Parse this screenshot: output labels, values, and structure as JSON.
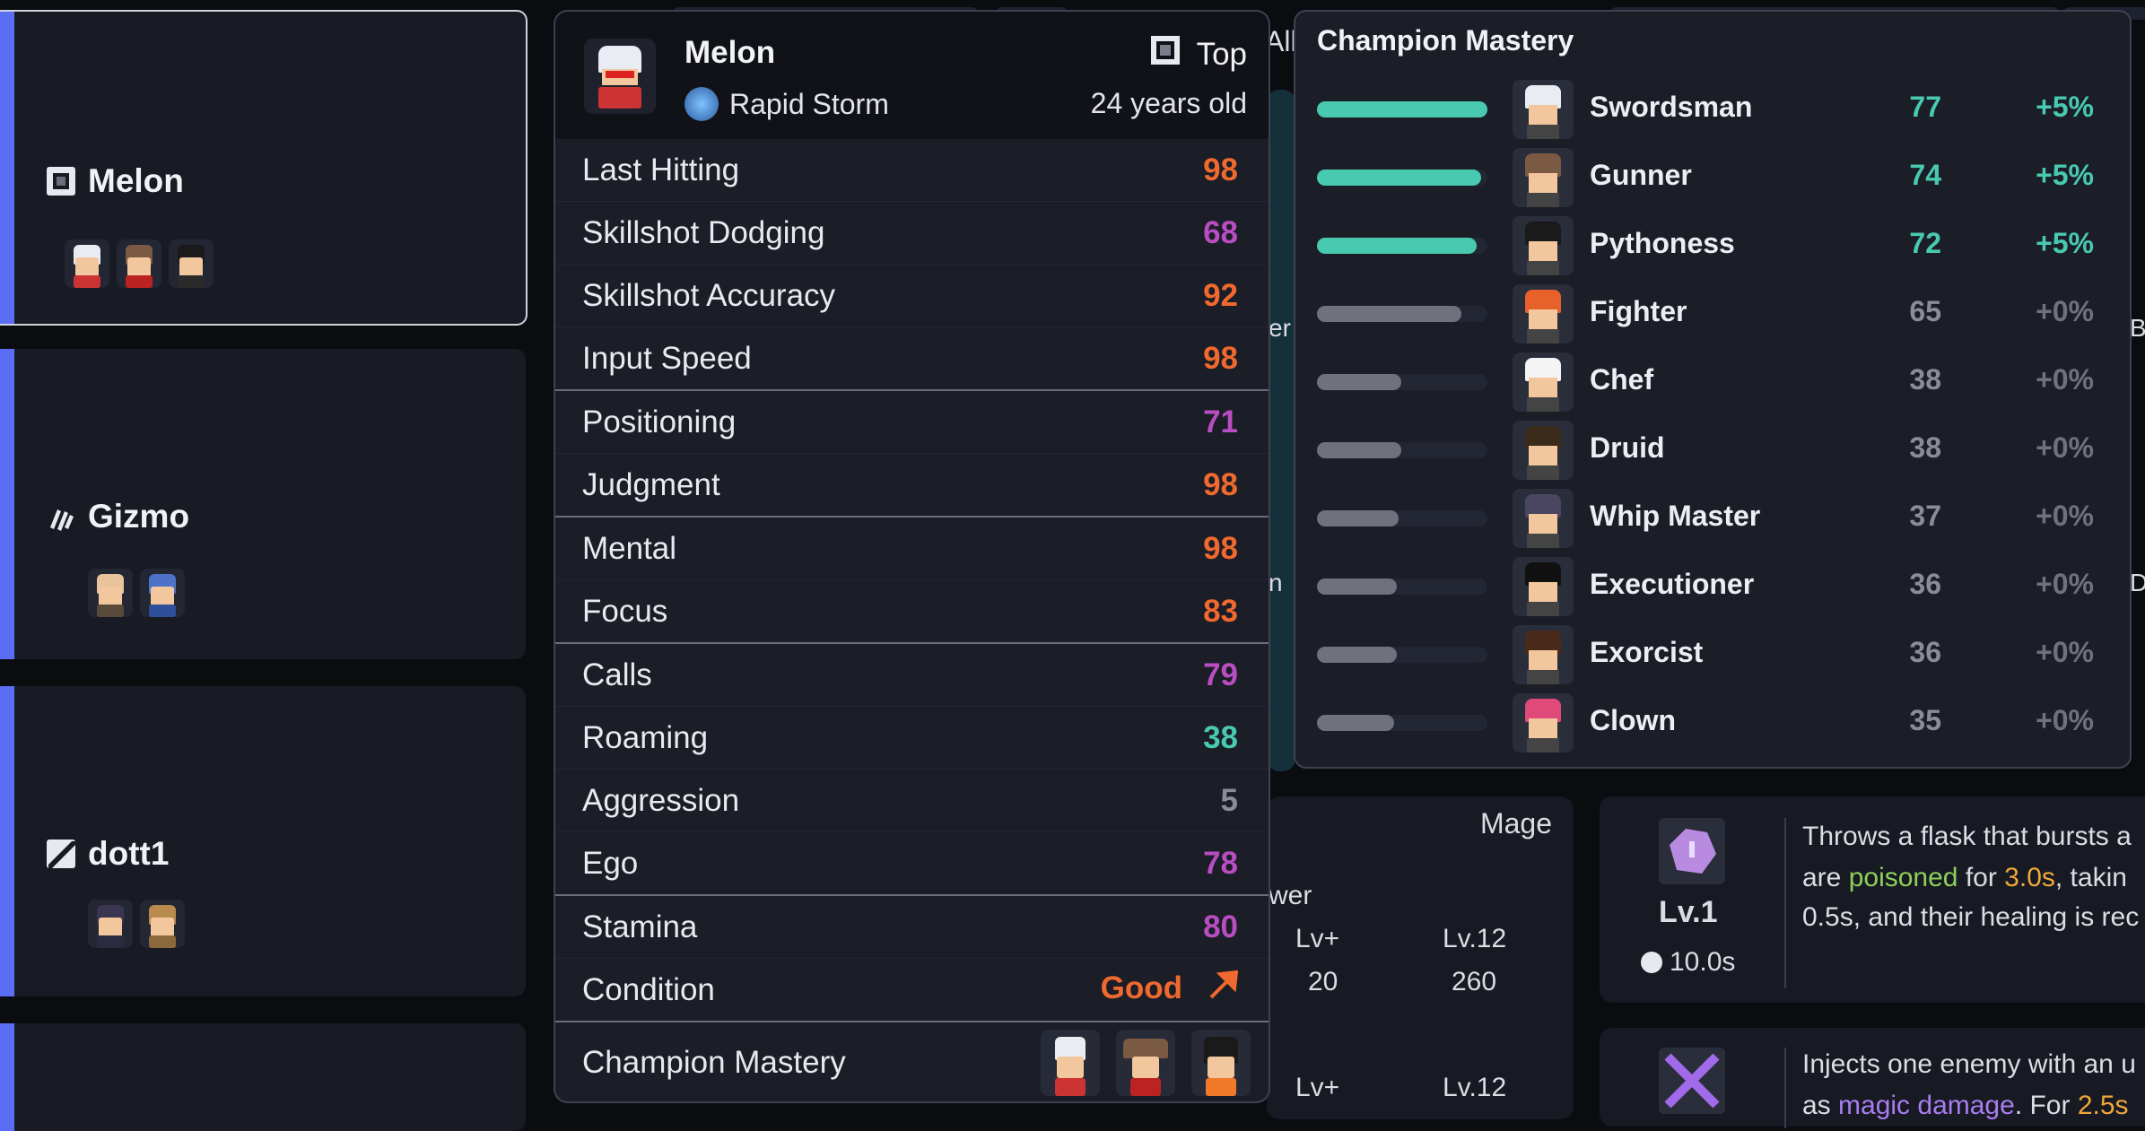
{
  "players": [
    {
      "name": "Melon",
      "team_icon": "rapid-storm-square-icon",
      "selected": true
    },
    {
      "name": "Gizmo",
      "team_icon": "claw-slash-icon",
      "selected": false
    },
    {
      "name": "dott1",
      "team_icon": "diagonal-slash-icon",
      "selected": false
    }
  ],
  "background": {
    "all_label": "All",
    "mage_label": "Mage",
    "power_label": "wer",
    "lvplus_label": "Lv+",
    "lv12_label": "Lv.12",
    "lvplus_value": "20",
    "lv12_value": "260",
    "lvplus_label2": "Lv+",
    "lv12_label2": "Lv.12",
    "partial_er": "er",
    "partial_n": "n",
    "partial_b": "B",
    "partial_d": "D",
    "skill1": {
      "level": "Lv.1",
      "cooldown": "10.0s",
      "line1": "Throws a flask that bursts a",
      "line2a": "are ",
      "line2_poison": "poisoned",
      "line2b": " for ",
      "line2_dur": "3.0s",
      "line2c": ", takin",
      "line3": "0.5s, and their healing is rec"
    },
    "skill2": {
      "line1": "Injects one enemy with an u",
      "line2a": "as ",
      "line2_magic": "magic damage",
      "line2b": ". For ",
      "line2_dur": "2.5s"
    }
  },
  "popup": {
    "name": "Melon",
    "team": "Rapid Storm",
    "position": "Top",
    "age": "24 years old",
    "groups": [
      [
        {
          "label": "Last Hitting",
          "value": "98",
          "color": "orange"
        },
        {
          "label": "Skillshot Dodging",
          "value": "68",
          "color": "purple"
        },
        {
          "label": "Skillshot Accuracy",
          "value": "92",
          "color": "orange"
        },
        {
          "label": "Input Speed",
          "value": "98",
          "color": "orange"
        }
      ],
      [
        {
          "label": "Positioning",
          "value": "71",
          "color": "purple"
        },
        {
          "label": "Judgment",
          "value": "98",
          "color": "orange"
        }
      ],
      [
        {
          "label": "Mental",
          "value": "98",
          "color": "orange"
        },
        {
          "label": "Focus",
          "value": "83",
          "color": "orange"
        }
      ],
      [
        {
          "label": "Calls",
          "value": "79",
          "color": "purple"
        },
        {
          "label": "Roaming",
          "value": "38",
          "color": "teal"
        },
        {
          "label": "Aggression",
          "value": "5",
          "color": "gray"
        },
        {
          "label": "Ego",
          "value": "78",
          "color": "purple"
        }
      ],
      [
        {
          "label": "Stamina",
          "value": "80",
          "color": "purple"
        },
        {
          "label": "Condition",
          "value": "Good",
          "color": "orange",
          "arrow": "up-right-arrow-icon"
        }
      ]
    ],
    "mastery_label": "Champion Mastery"
  },
  "mastery_panel": {
    "title": "Champion Mastery",
    "accent": "#48c9b0",
    "champions": [
      {
        "name": "Swordsman",
        "level": 77,
        "bonus": "+5%",
        "top": true
      },
      {
        "name": "Gunner",
        "level": 74,
        "bonus": "+5%",
        "top": true
      },
      {
        "name": "Pythoness",
        "level": 72,
        "bonus": "+5%",
        "top": true
      },
      {
        "name": "Fighter",
        "level": 65,
        "bonus": "+0%",
        "top": false
      },
      {
        "name": "Chef",
        "level": 38,
        "bonus": "+0%",
        "top": false
      },
      {
        "name": "Druid",
        "level": 38,
        "bonus": "+0%",
        "top": false
      },
      {
        "name": "Whip Master",
        "level": 37,
        "bonus": "+0%",
        "top": false
      },
      {
        "name": "Executioner",
        "level": 36,
        "bonus": "+0%",
        "top": false
      },
      {
        "name": "Exorcist",
        "level": 36,
        "bonus": "+0%",
        "top": false
      },
      {
        "name": "Clown",
        "level": 35,
        "bonus": "+0%",
        "top": false
      }
    ]
  }
}
